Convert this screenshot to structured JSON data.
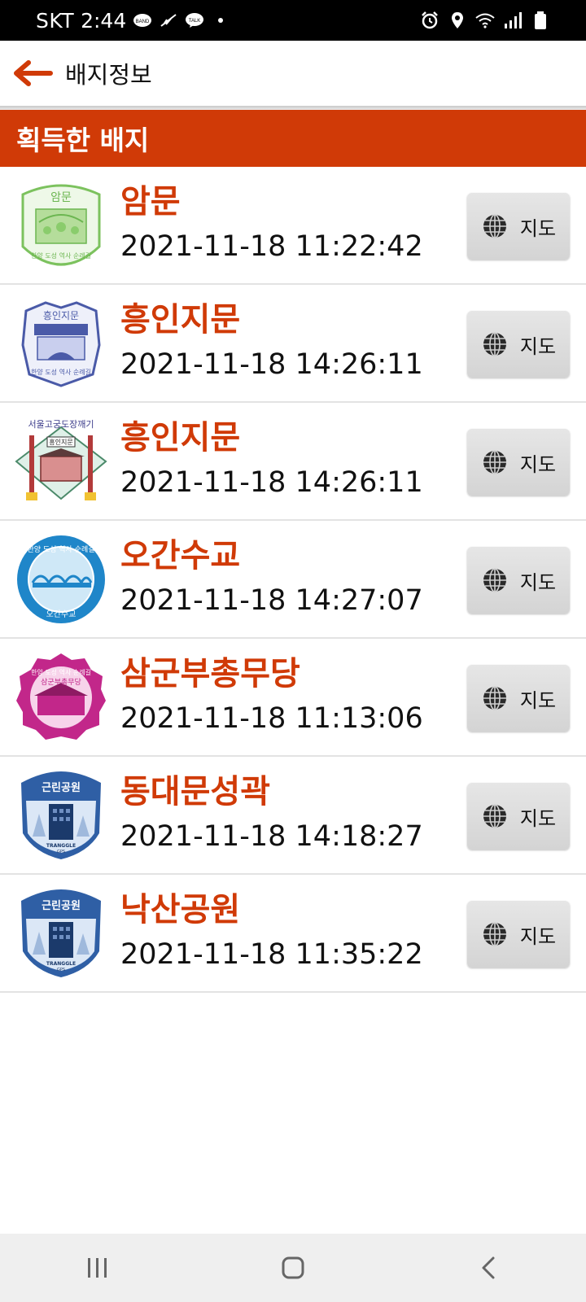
{
  "status_bar": {
    "carrier": "SKT",
    "time": "2:44",
    "notifications": [
      "band-icon",
      "feather-icon",
      "talk-icon",
      "dot-icon"
    ],
    "system_icons": [
      "alarm-icon",
      "location-icon",
      "wifi-icon",
      "signal-icon",
      "battery-icon"
    ]
  },
  "app_bar": {
    "back_icon": "arrow-left-icon",
    "title": "배지정보"
  },
  "section": {
    "title": "획득한 배지"
  },
  "badges": [
    {
      "name": "암문",
      "date": "2021-11-18 11:22:42",
      "map_label": "지도",
      "badge_icon": "seal-green-badge",
      "color": "#6cb651"
    },
    {
      "name": "흥인지문",
      "date": "2021-11-18 14:26:11",
      "map_label": "지도",
      "badge_icon": "seal-purple-badge",
      "color": "#4a5aa8"
    },
    {
      "name": "흥인지문",
      "date": "2021-11-18 14:26:11",
      "map_label": "지도",
      "badge_icon": "gate-diamond-badge",
      "color": "#3b6aa8"
    },
    {
      "name": "오간수교",
      "date": "2021-11-18 14:27:07",
      "map_label": "지도",
      "badge_icon": "seal-blue-badge",
      "color": "#1f86c9"
    },
    {
      "name": "삼군부총무당",
      "date": "2021-11-18 11:13:06",
      "map_label": "지도",
      "badge_icon": "seal-magenta-badge",
      "color": "#c2278a"
    },
    {
      "name": "동대문성곽",
      "date": "2021-11-18 14:18:27",
      "map_label": "지도",
      "badge_icon": "park-shield-badge",
      "color": "#2f5fa5"
    },
    {
      "name": "낙산공원",
      "date": "2021-11-18 11:35:22",
      "map_label": "지도",
      "badge_icon": "park-shield-badge",
      "color": "#2f5fa5"
    }
  ],
  "badge_text": {
    "seal_top_amun": "암문",
    "seal_bottom": "한양 도성 역사 순례길",
    "seal_top_heungin": "흥인지문",
    "gate_title": "서울고궁도장깨기",
    "gate_label": "흥인지문",
    "seal_bottom_ogan": "오간수교",
    "seal_top_samgun": "한양 도성 역사 순례길",
    "seal_sub_samgun": "삼군부총무당",
    "park_label": "근린공원",
    "park_brand": "TRANGGLE",
    "park_brand_sub": "GPS"
  },
  "colors": {
    "accent": "#d03a07",
    "status_bg": "#000000",
    "nav_bg": "#efefef"
  },
  "nav_bar": {
    "icons": [
      "recents-icon",
      "home-icon",
      "back-icon"
    ]
  }
}
